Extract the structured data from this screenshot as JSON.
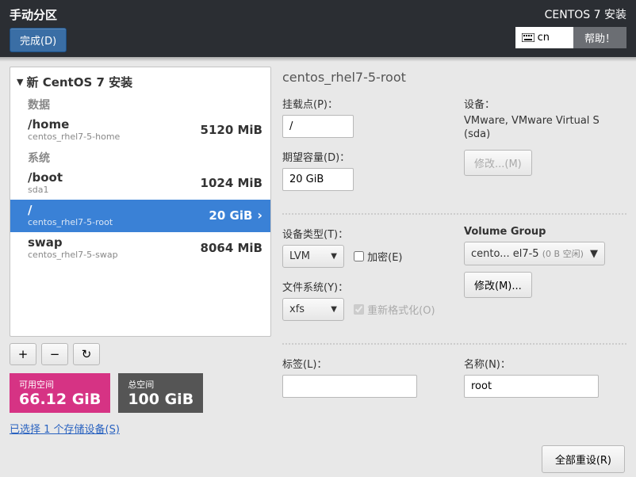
{
  "header": {
    "title": "手动分区",
    "done_btn": "完成(D)",
    "install_title": "CENTOS 7 安装",
    "lang_code": "cn",
    "help_btn": "帮助！"
  },
  "tree": {
    "title": "新 CentOS 7 安装",
    "categories": [
      {
        "label": "数据",
        "items": [
          {
            "name": "/home",
            "sub": "centos_rhel7-5-home",
            "size": "5120 MiB",
            "selected": false
          }
        ]
      },
      {
        "label": "系统",
        "items": [
          {
            "name": "/boot",
            "sub": "sda1",
            "size": "1024 MiB",
            "selected": false
          },
          {
            "name": "/",
            "sub": "centos_rhel7-5-root",
            "size": "20 GiB",
            "selected": true
          },
          {
            "name": "swap",
            "sub": "centos_rhel7-5-swap",
            "size": "8064 MiB",
            "selected": false
          }
        ]
      }
    ]
  },
  "controls": {
    "add": "+",
    "remove": "−",
    "reload": "↻"
  },
  "space": {
    "avail_label": "可用空间",
    "avail_value": "66.12 GiB",
    "total_label": "总空间",
    "total_value": "100 GiB"
  },
  "storage_link": "已选择 1 个存储设备(S)",
  "detail": {
    "title": "centos_rhel7-5-root",
    "mount_label": "挂载点(P)：",
    "mount_value": "/",
    "capacity_label": "期望容量(D)：",
    "capacity_value": "20 GiB",
    "device_label": "设备：",
    "device_text": "VMware, VMware Virtual S (sda)",
    "modify_btn_disabled": "修改...(M)",
    "devtype_label": "设备类型(T)：",
    "devtype_value": "LVM",
    "encrypt_label": "加密(E)",
    "fs_label": "文件系统(Y)：",
    "fs_value": "xfs",
    "reformat_label": "重新格式化(O)",
    "vg_label": "Volume Group",
    "vg_value": "cento... el7-5",
    "vg_free": "(0 B 空闲)",
    "modify_btn": "修改(M)...",
    "label_label": "标签(L)：",
    "label_value": "",
    "name_label": "名称(N)：",
    "name_value": "root"
  },
  "footer": {
    "reset_btn": "全部重设(R)"
  }
}
